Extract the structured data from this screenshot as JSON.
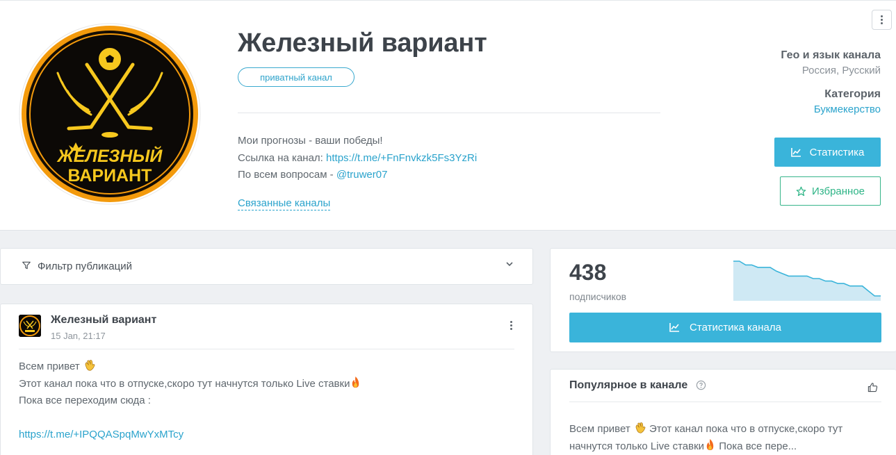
{
  "channel": {
    "title": "Железный вариант",
    "badge": "приватный канал",
    "logo_line1": "ЖЕЛЕЗНЫЙ",
    "logo_line2": "ВАРИАНТ",
    "description": {
      "line1": "Мои прогнозы - ваши победы!",
      "line2_prefix": "Ссылка на канал: ",
      "line2_link": "https://t.me/+FnFnvkzk5Fs3YzRi",
      "line3_prefix": "По всем вопросам - ",
      "line3_link": "@truwer07"
    },
    "related_label": "Связанные каналы"
  },
  "meta": {
    "geo_label": "Гео и язык канала",
    "geo_value": "Россия, Русский",
    "category_label": "Категория",
    "category_value": "Букмекерство"
  },
  "buttons": {
    "stats": "Статистика",
    "favorite": "Избранное",
    "channel_stats": "Статистика канала"
  },
  "filter": {
    "label": "Фильтр публикаций"
  },
  "post": {
    "author": "Железный вариант",
    "date": "15 Jan, 21:17",
    "line1": "Всем привет ",
    "line2": "Этот канал пока что в отпуске,скоро тут начнутся только Live ставки",
    "line3": "Пока все переходим сюда :",
    "link": "https://t.me/+IPQQASpqMwYxMTcy"
  },
  "subscribers": {
    "count": "438",
    "label": "подписчиков",
    "trend": [
      440,
      440,
      439.7,
      439.7,
      439.5,
      439.5,
      439.5,
      439.2,
      439,
      438.8,
      438.8,
      438.8,
      438.8,
      438.6,
      438.6,
      438.4,
      438.4,
      438.2,
      438.2,
      438,
      438,
      438,
      437.6,
      437.2,
      437.2
    ]
  },
  "popular": {
    "title": "Популярное в канале",
    "text_part1": "Всем привет ",
    "text_part2": " Этот канал пока что в отпуске,скоро тут начнутся только Live ставки",
    "text_part3": " Пока все пере..."
  },
  "colors": {
    "accent": "#3ab4da",
    "link": "#2aa3cc",
    "favorite": "#2db486",
    "logo_orange": "#f39a0c",
    "logo_yellow": "#f7c81e"
  },
  "icons": [
    "more-vertical-icon",
    "chart-line-icon",
    "star-icon",
    "filter-icon",
    "chevron-down-icon",
    "question-circle-icon",
    "thumbs-up-icon",
    "waving-hand-emoji",
    "fire-emoji"
  ]
}
